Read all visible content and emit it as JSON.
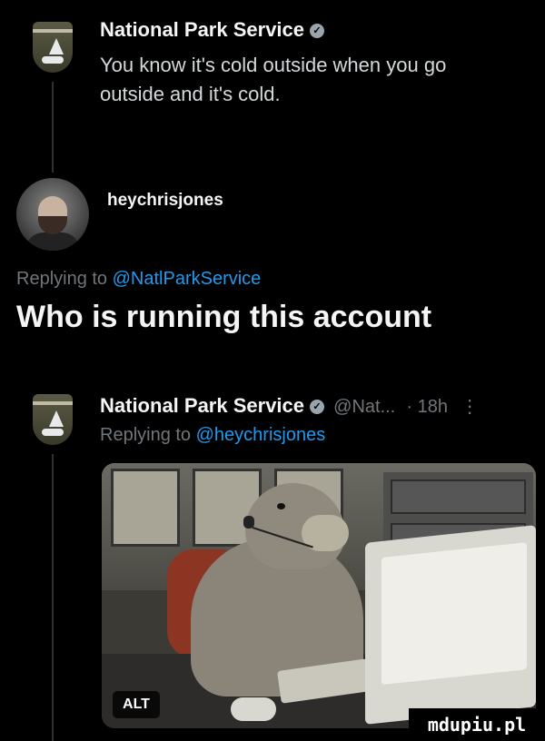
{
  "tweet1": {
    "author": "National Park Service",
    "text_line1": "You know it's cold outside when you go",
    "text_line2": "outside and it's cold."
  },
  "tweet2": {
    "author": "heychrisjones",
    "replying_prefix": "Replying to ",
    "replying_handle": "@NatlParkService",
    "text": "Who is running this account"
  },
  "tweet3": {
    "author": "National Park Service",
    "handle": "@Nat...",
    "time": "· 18h",
    "more": "⋮",
    "replying_prefix": "Replying to ",
    "replying_handle": "@heychrisjones",
    "image_alt_badge": "ALT"
  },
  "icons": {
    "verified": "verified-badge-icon"
  },
  "colors": {
    "link": "#1d9bf0",
    "background": "#000000"
  },
  "watermark": "mdupiu.pl"
}
